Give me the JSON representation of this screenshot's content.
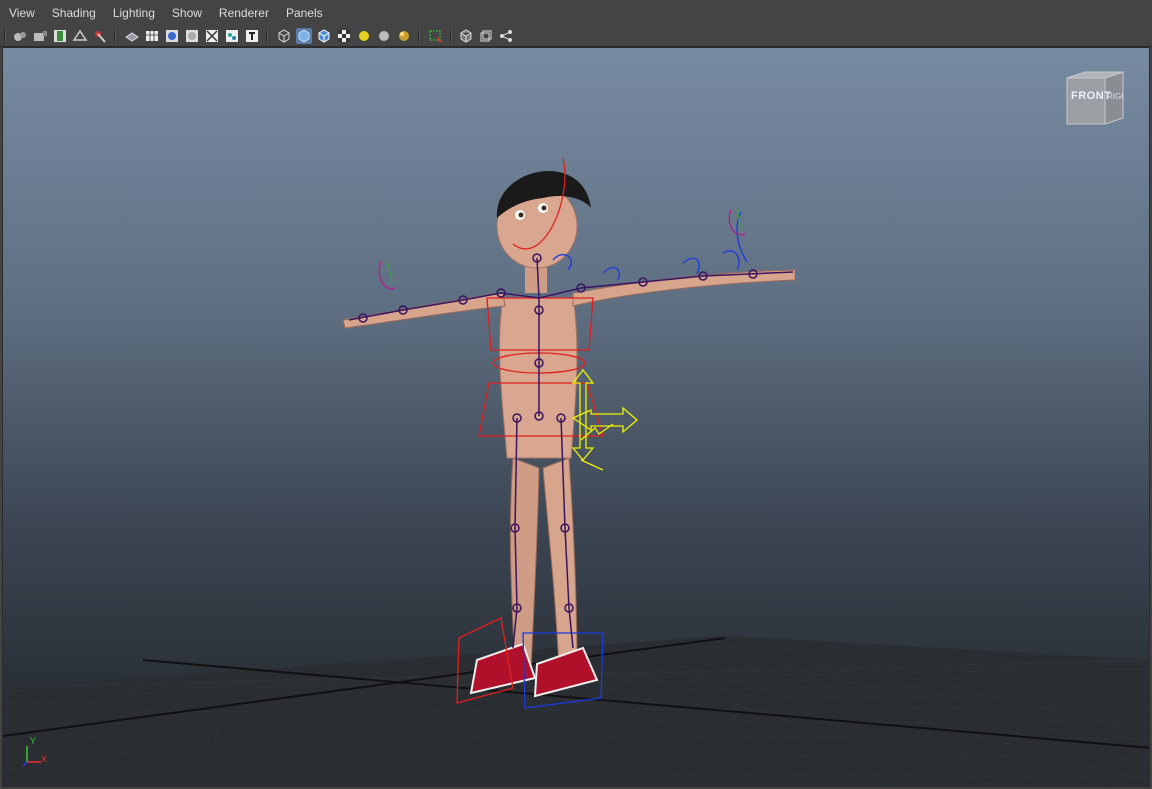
{
  "menubar": {
    "items": [
      "View",
      "Shading",
      "Lighting",
      "Show",
      "Renderer",
      "Panels"
    ]
  },
  "viewcube": {
    "front_label": "FRONT",
    "right_label": "RIGHT"
  },
  "axis_indicator": {
    "y_label": "Y",
    "x_label": "X"
  },
  "toolbar": {
    "icons": [
      "camera-select-icon",
      "camera-attributes-icon",
      "film-gate-icon",
      "resolution-gate-icon",
      "image-plane-icon",
      "grid-icon",
      "wireframe-icon",
      "smooth-shade-icon",
      "flat-shade-icon",
      "xray-icon",
      "xray-joints-icon",
      "textured-icon",
      "default-lights-icon",
      "wireframe-on-shaded-icon",
      "smooth-shade-all-icon",
      "bounding-box-icon",
      "checker-icon",
      "use-lights-icon",
      "shadows-icon",
      "highlight-icon",
      "isolate-select-icon",
      "cube-icon",
      "ortho-icon",
      "camera-rig-icon"
    ]
  },
  "colors": {
    "menubar_bg": "#444444",
    "viewport_top": "#778ba2",
    "viewport_bottom": "#202327",
    "joint_color": "#3a1560",
    "control_red": "#e0201c",
    "control_blue": "#1a3be0",
    "control_yellow": "#f0f000",
    "skin": "#d7a48c",
    "shoe_red": "#b0102a"
  }
}
